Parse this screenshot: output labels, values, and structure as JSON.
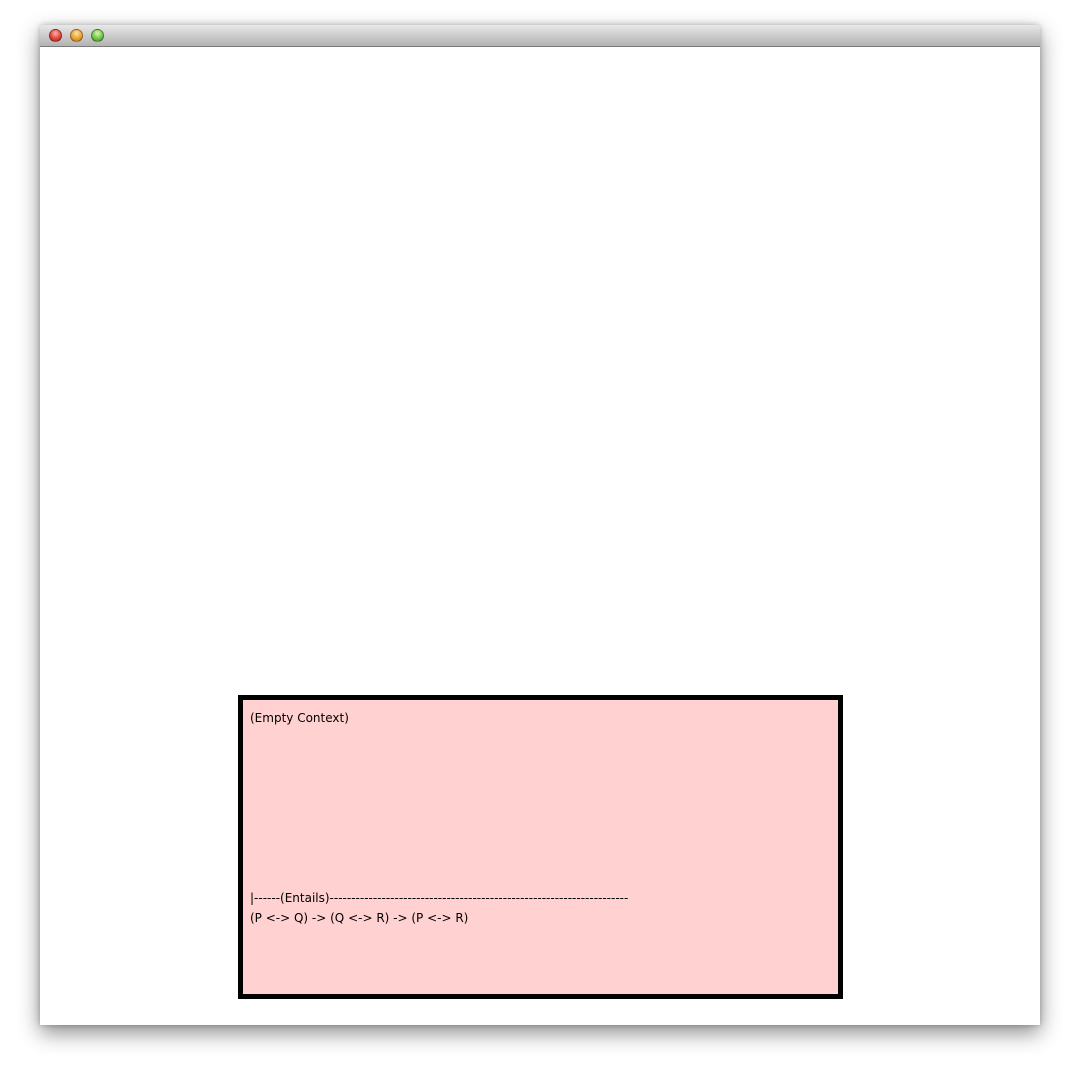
{
  "window": {
    "title": "",
    "controls": [
      "close",
      "minimize",
      "zoom"
    ]
  },
  "proof": {
    "context_label": "(Empty Context)",
    "entails_line": "|------(Entails)---------------------------------------------------------------------",
    "formula": "(P <-> Q) -> (Q <-> R) -> (P <-> R)",
    "box_background": "#ffd1d1",
    "box_border_color": "#000000"
  }
}
